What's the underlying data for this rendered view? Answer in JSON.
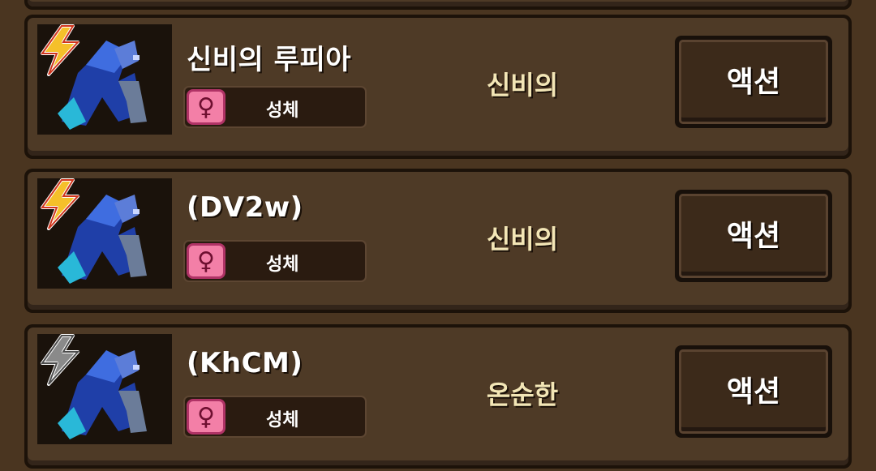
{
  "pets": [
    {
      "name": "신비의 루피아",
      "gender_icon": "female-icon",
      "gender_symbol": "♀",
      "type_label": "성체",
      "trait": "신비의",
      "energy": "charged",
      "action_label": "액션"
    },
    {
      "name": "(DV2w)",
      "gender_icon": "female-icon",
      "gender_symbol": "♀",
      "type_label": "성체",
      "trait": "신비의",
      "energy": "charged",
      "action_label": "액션"
    },
    {
      "name": "(KhCM)",
      "gender_icon": "female-icon",
      "gender_symbol": "♀",
      "type_label": "성체",
      "trait": "온순한",
      "energy": "empty",
      "action_label": "액션"
    }
  ],
  "colors": {
    "bolt_charged": "#f5c02a",
    "bolt_empty": "#8a8a8a",
    "gender_badge": "#f37fa7"
  }
}
